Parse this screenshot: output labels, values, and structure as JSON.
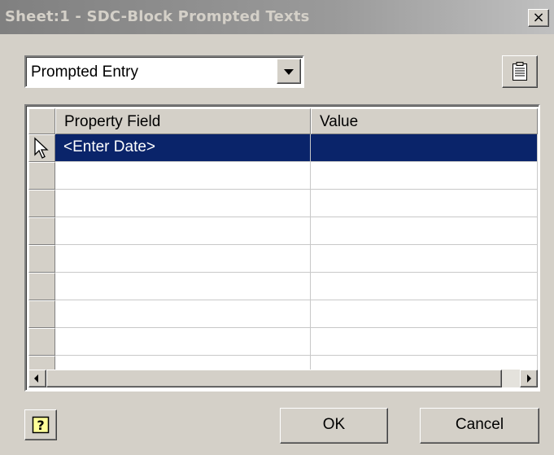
{
  "window": {
    "title": "Sheet:1 - SDC-Block Prompted Texts",
    "close_glyph": "×"
  },
  "entry_type": {
    "selected": "Prompted Entry"
  },
  "notes_button": {
    "icon": "notes-icon"
  },
  "grid": {
    "columns": [
      "Property Field",
      "Value"
    ],
    "rows": [
      {
        "property_field": "<Enter Date>",
        "value": ""
      },
      {
        "property_field": "",
        "value": ""
      },
      {
        "property_field": "",
        "value": ""
      },
      {
        "property_field": "",
        "value": ""
      },
      {
        "property_field": "",
        "value": ""
      },
      {
        "property_field": "",
        "value": ""
      },
      {
        "property_field": "",
        "value": ""
      },
      {
        "property_field": "",
        "value": ""
      }
    ],
    "selected_row": 1
  },
  "buttons": {
    "help_icon": "help-icon",
    "ok": "OK",
    "cancel": "Cancel"
  },
  "colors": {
    "dialog_bg": "#d4d0c8",
    "selection": "#0a246a",
    "titlebar_inactive": "#808080"
  }
}
